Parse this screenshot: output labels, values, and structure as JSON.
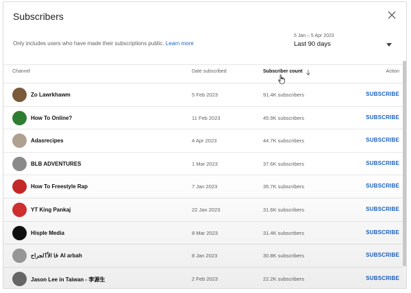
{
  "dialog": {
    "title": "Subscribers",
    "note_text": "Only includes users who have made their subscriptions public.",
    "note_link": "Learn more",
    "date_range": {
      "dates": "5 Jan – 5 Apr 2023",
      "label": "Last 90 days"
    }
  },
  "table": {
    "headers": {
      "channel": "Channel",
      "date": "Date subscribed",
      "count": "Subscriber count",
      "action": "Action"
    },
    "rows": [
      {
        "name": "Zo Lawrkhawm",
        "date": "5 Feb 2023",
        "subs": "91.4K subscribers",
        "action": "SUBSCRIBE",
        "avatar_color": "#7a5a3a",
        "avatar_text": ""
      },
      {
        "name": "How To Online?",
        "date": "11 Feb 2023",
        "subs": "45.9K subscribers",
        "action": "SUBSCRIBE",
        "avatar_color": "#2e7d32",
        "avatar_text": ""
      },
      {
        "name": "Adasrecipes",
        "date": "4 Apr 2023",
        "subs": "44.7K subscribers",
        "action": "SUBSCRIBE",
        "avatar_color": "#b0a090",
        "avatar_text": ""
      },
      {
        "name": "BLB ADVENTURES",
        "date": "1 Mar 2023",
        "subs": "37.6K subscribers",
        "action": "SUBSCRIBE",
        "avatar_color": "#8a8a8a",
        "avatar_text": ""
      },
      {
        "name": "How To Freestyle Rap",
        "date": "7 Jan 2023",
        "subs": "35.7K subscribers",
        "action": "SUBSCRIBE",
        "avatar_color": "#c62828",
        "avatar_text": ""
      },
      {
        "name": "YT King Pankaj",
        "date": "22 Jan 2023",
        "subs": "31.6K subscribers",
        "action": "SUBSCRIBE",
        "avatar_color": "#d32f2f",
        "avatar_text": ""
      },
      {
        "name": "Hisple Media",
        "date": "8 Mar 2023",
        "subs": "31.4K subscribers",
        "action": "SUBSCRIBE",
        "avatar_color": "#111111",
        "avatar_text": ""
      },
      {
        "name": "ځا الاُٱلجراح Al arbah",
        "date": "8 Jan 2023",
        "subs": "30.8K subscribers",
        "action": "SUBSCRIBE",
        "avatar_color": "#9e9e9e",
        "avatar_text": ""
      },
      {
        "name": "Jason Lee in Taiwan - 李源生",
        "date": "2 Feb 2023",
        "subs": "22.2K subscribers",
        "action": "SUBSCRIBE",
        "avatar_color": "#6d6d6d",
        "avatar_text": ""
      }
    ]
  },
  "colors": {
    "link": "#1a62c4",
    "text": "#0f0f0f",
    "muted": "#606060"
  },
  "icons": {
    "close": "close-icon",
    "dropdown": "caret-down-icon",
    "sort": "arrow-down-icon",
    "cursor": "pointer-hand-icon"
  }
}
